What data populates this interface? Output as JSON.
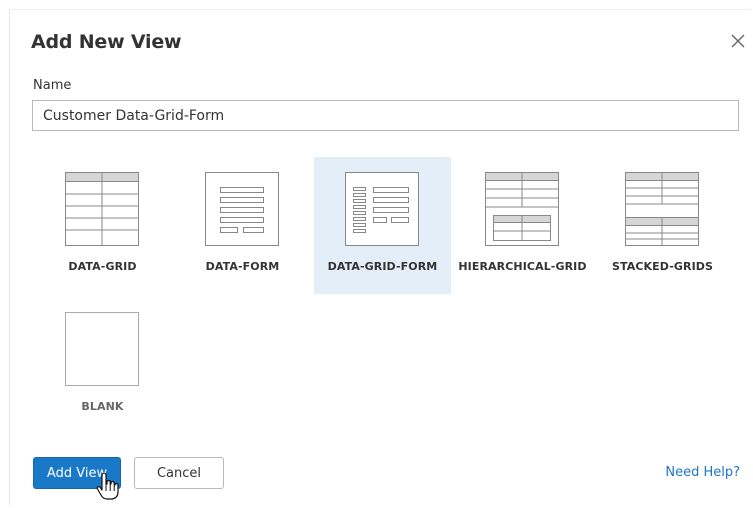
{
  "dialog": {
    "title": "Add New View",
    "close_icon": "close-icon"
  },
  "name_field": {
    "label": "Name",
    "value": "Customer Data-Grid-Form"
  },
  "view_types": [
    {
      "label": "DATA-GRID",
      "icon": "data-grid-icon",
      "selected": false
    },
    {
      "label": "DATA-FORM",
      "icon": "data-form-icon",
      "selected": false
    },
    {
      "label": "DATA-GRID-FORM",
      "icon": "data-grid-form-icon",
      "selected": true
    },
    {
      "label": "HIERARCHICAL-GRID",
      "icon": "hierarchical-grid-icon",
      "selected": false
    },
    {
      "label": "STACKED-GRIDS",
      "icon": "stacked-grids-icon",
      "selected": false
    },
    {
      "label": "BLANK",
      "icon": "blank-icon",
      "selected": false
    }
  ],
  "footer": {
    "add_label": "Add View",
    "cancel_label": "Cancel",
    "help_label": "Need Help?"
  },
  "colors": {
    "primary": "#1a78c8",
    "selected_tile": "#e4eef8",
    "text": "#333333",
    "link": "#1a78c8"
  }
}
